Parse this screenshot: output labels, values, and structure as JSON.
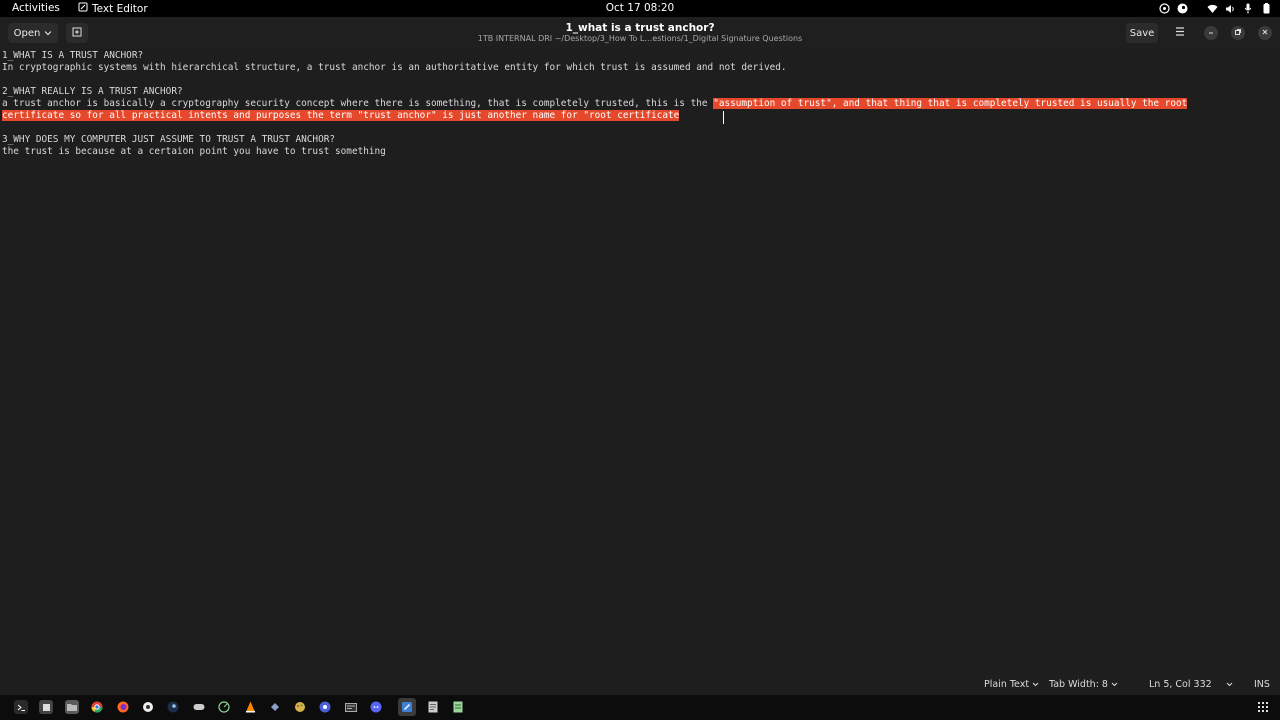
{
  "topbar": {
    "activities": "Activities",
    "app_name": "Text Editor",
    "clock": "Oct 17  08:20",
    "tray_icons": [
      "color-icon",
      "steam-icon",
      "wifi-icon",
      "volume-icon",
      "microphone-icon",
      "battery-icon"
    ]
  },
  "headerbar": {
    "open_label": "Open",
    "title": "1_what is a trust anchor?",
    "subtitle": "1TB INTERNAL DRI ~/Desktop/3_How To L…estions/1_Digital Signature Questions",
    "save_label": "Save"
  },
  "document": {
    "lines": [
      "1_WHAT IS A TRUST ANCHOR?",
      "In cryptographic systems with hierarchical structure, a trust anchor is an authoritative entity for which trust is assumed and not derived.",
      "",
      "2_WHAT REALLY IS A TRUST ANCHOR?",
      "",
      "",
      "",
      "3_WHY DOES MY COMPUTER JUST ASSUME TO TRUST A TRUST ANCHOR?",
      "the trust is because at a certaion point you have to trust something"
    ],
    "line5_plain": "a trust anchor is basically a cryptography security concept where there is something, that is completely trusted, this is the ",
    "line5_selected": "\"assumption of trust\", and that thing that is completely trusted is usually the root",
    "line6_selected": "certificate so for all practical intents and purposes the term \"trust anchor\" is just another name for \"root certificate"
  },
  "statusbar": {
    "language": "Plain Text",
    "tab_width": "Tab Width: 8",
    "position": "Ln 5, Col 332",
    "mode": "INS"
  },
  "dock": {
    "icons": [
      "terminal-icon",
      "files-manager-icon",
      "folder-icon",
      "chrome-icon",
      "firefox-icon",
      "settings-icon",
      "steam-icon",
      "game-icon",
      "system-monitor-icon",
      "vlc-icon",
      "app-icon",
      "paint-icon",
      "proton-icon",
      "terminal2-icon",
      "discord-icon",
      "text-editor-icon",
      "notes-icon",
      "document-icon",
      "apps-grid-icon"
    ]
  },
  "colors": {
    "selection": "#e5482b",
    "editor_bg": "#1e1e1e",
    "topbar_bg": "#000000"
  }
}
